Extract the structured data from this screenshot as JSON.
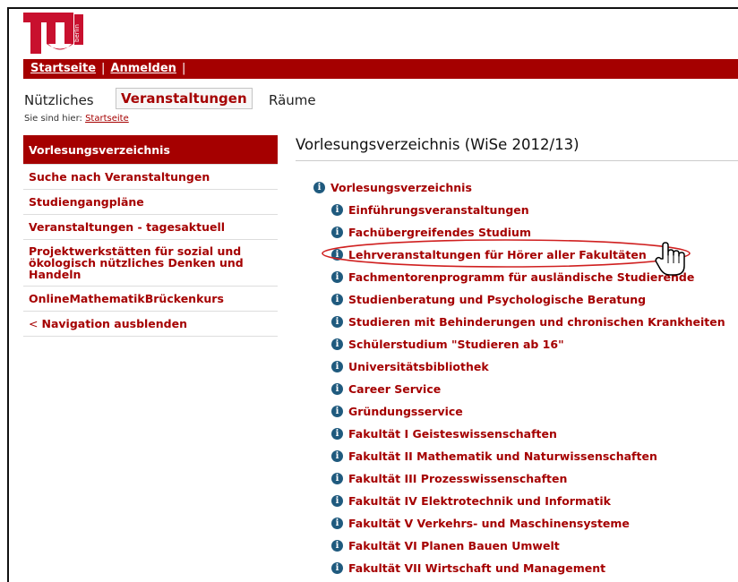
{
  "brand": {
    "logo_text": "TU",
    "logo_sub": "berlin"
  },
  "topbar": {
    "home": "Startseite",
    "separator": "|",
    "login": "Anmelden"
  },
  "mainnav": [
    "Nützliches",
    "Veranstaltungen",
    "Räume"
  ],
  "breadcrumb": {
    "label": "Sie sind hier:",
    "link": "Startseite"
  },
  "sidebar": {
    "items": [
      "Vorlesungsverzeichnis",
      "Suche nach Veranstaltungen",
      "Studiengangpläne",
      "Veranstaltungen - tagesaktuell",
      "Projektwerkstätten für sozial und ökologisch nützliches Denken und Handeln",
      "OnlineMathematikBrückenkurs"
    ],
    "hide_nav": "Navigation ausblenden",
    "hide_nav_symbol": "<"
  },
  "content": {
    "title": "Vorlesungsverzeichnis (WiSe 2012/13)",
    "root": "Vorlesungsverzeichnis",
    "entries": [
      "Einführungsveranstaltungen",
      "Fachübergreifendes Studium",
      "Lehrveranstaltungen für Hörer aller Fakultäten",
      "Fachmentorenprogramm für ausländische Studierende",
      "Studienberatung und Psychologische Beratung",
      "Studieren mit Behinderungen und chronischen Krankheiten",
      "Schülerstudium \"Studieren ab 16\"",
      "Universitätsbibliothek",
      "Career Service",
      "Gründungsservice",
      "Fakultät I Geisteswissenschaften",
      "Fakultät II Mathematik und Naturwissenschaften",
      "Fakultät III Prozesswissenschaften",
      "Fakultät IV Elektrotechnik und Informatik",
      "Fakultät V Verkehrs- und Maschinensysteme",
      "Fakultät VI Planen Bauen Umwelt",
      "Fakultät VII Wirtschaft und Management"
    ]
  },
  "colors": {
    "accent": "#a50000",
    "info": "#1f5a7e",
    "highlight": "#d02020"
  },
  "icons": {
    "info": "info-icon",
    "cursor": "hand-cursor-icon"
  }
}
